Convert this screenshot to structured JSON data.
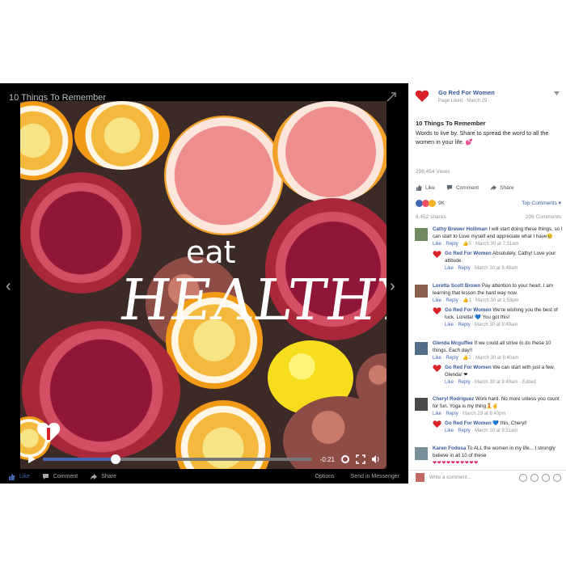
{
  "video": {
    "title": "10 Things To Remember",
    "overlay_eat": "eat",
    "overlay_healthy": "HEALTHY",
    "time_remaining": "-0:21",
    "progress": 0.27
  },
  "video_bar": {
    "like": "Like",
    "comment": "Comment",
    "share": "Share",
    "options": "Options",
    "send": "Send in Messenger"
  },
  "post": {
    "page_name": "Go Red For Women",
    "page_meta": "Page Liked · March 29 ·",
    "title": "10 Things To Remember",
    "text": "Words to live by. Share to spread the word to all the women in your life. 💕",
    "views": "298,454 Views",
    "like": "Like",
    "comment": "Comment",
    "share": "Share",
    "reactions_count": "9K",
    "top_comments": "Top Comments ▾",
    "shares": "6,452 shares",
    "comments_count": "206 Comments"
  },
  "comments": [
    {
      "name": "Cathy Brewer Holliman",
      "text": "I will start doing these things, so I can start to Love myself and appreciate what I have😢",
      "meta": {
        "like": "Like",
        "reply": "Reply",
        "rest": "· 👍5 · March 30 at 7:31am"
      },
      "reply": {
        "name": "Go Red For Women",
        "text": "Absolutely, Cathy! Love your attitude.",
        "meta": {
          "like": "Like",
          "reply": "Reply",
          "rest": "· March 30 at 9:48am"
        }
      }
    },
    {
      "name": "Loretta Scott Brown",
      "text": "Pay attention to your heart. I am learning that lesson the hard way now.",
      "meta": {
        "like": "Like",
        "reply": "Reply",
        "rest": "· 👍1 · March 30 at 1:58pm"
      },
      "reply": {
        "name": "Go Red For Women",
        "text": "We're wishing you the best of luck, Loretta! 💙 You got this!",
        "meta": {
          "like": "Like",
          "reply": "Reply",
          "rest": "· March 30 at 9:49am"
        }
      }
    },
    {
      "name": "Glenda Mcguffee",
      "text": "If we could all strive to do these 10 things. Each day!!",
      "meta": {
        "like": "Like",
        "reply": "Reply",
        "rest": "· 👍2 · March 30 at 8:40am"
      },
      "reply": {
        "name": "Go Red For Women",
        "text": "We can start with just a few, Glenda! ❤",
        "meta": {
          "like": "Like",
          "reply": "Reply",
          "rest": "· March 30 at 9:49am · Edited"
        }
      }
    },
    {
      "name": "Cheryl Rodriguez",
      "text": "Work hard. No more unless you count for fun. Yoga is my thing🧘✌",
      "meta": {
        "like": "Like",
        "reply": "Reply",
        "rest": "· March 29 at 9:40pm"
      },
      "reply": {
        "name": "Go Red For Women",
        "text": "💙 this, Cheryl!",
        "meta": {
          "like": "Like",
          "reply": "Reply",
          "rest": "· March 30 at 9:51am"
        }
      }
    },
    {
      "name": "Karen Fodusa",
      "text": "To ALL the women in my life... I strongly believe in all 10 of these",
      "hearts": "❤❤❤❤❤❤❤❤❤❤"
    }
  ],
  "write_comment_placeholder": "Write a comment...",
  "colors": {
    "brand_blue": "#4267b2",
    "link_blue": "#365899",
    "go_red": "#d8232a"
  }
}
